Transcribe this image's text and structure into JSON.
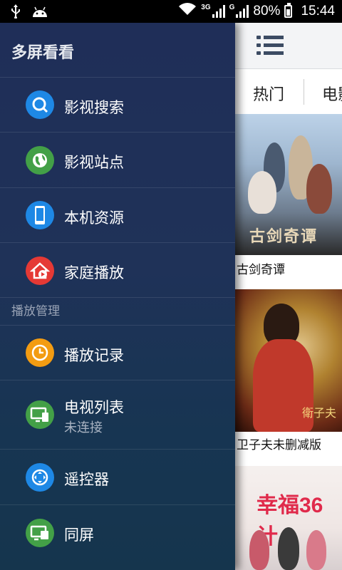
{
  "status_bar": {
    "network_3g": "3G",
    "network_g": "G",
    "battery_percent": "80%",
    "time": "15:44",
    "icons": [
      "usb-icon",
      "android-icon",
      "wifi-icon",
      "signal-icon",
      "battery-charging-icon"
    ]
  },
  "drawer": {
    "title": "多屏看看",
    "items": [
      {
        "label": "影视搜索",
        "icon": "search-icon",
        "color": "#1e88e5"
      },
      {
        "label": "影视站点",
        "icon": "globe-icon",
        "color": "#43a047"
      },
      {
        "label": "本机资源",
        "icon": "phone-icon",
        "color": "#1e88e5"
      },
      {
        "label": "家庭播放",
        "icon": "home-play-icon",
        "color": "#e53935"
      }
    ],
    "section_title": "播放管理",
    "manage_items": [
      {
        "label": "播放记录",
        "icon": "clock-icon",
        "color": "#f39c12"
      },
      {
        "label": "电视列表",
        "sublabel": "未连接",
        "icon": "tv-list-icon",
        "color": "#43a047"
      },
      {
        "label": "遥控器",
        "icon": "remote-icon",
        "color": "#1e88e5"
      },
      {
        "label": "同屏",
        "icon": "screen-mirror-icon",
        "color": "#43a047"
      }
    ]
  },
  "content": {
    "menu_icon": "list-menu-icon",
    "tabs": [
      "热门",
      "电影"
    ],
    "videos": [
      {
        "title": "古剑奇谭",
        "poster_text": "古剑奇谭"
      },
      {
        "title": "卫子夫未删减版",
        "poster_text": "衛子夫"
      },
      {
        "title": "",
        "poster_text": "幸福36计"
      }
    ]
  }
}
